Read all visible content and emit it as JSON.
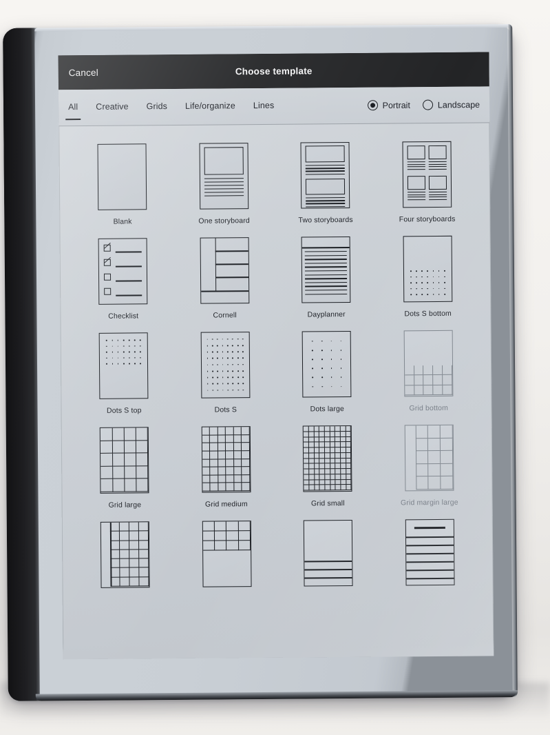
{
  "device": {
    "kind": "e-ink-tablet",
    "bezel_color": "#1d1d1f",
    "body_color": "#c9cfd5"
  },
  "screen": {
    "background_color": "#cbd0d6",
    "ink_color": "#1b1e23"
  },
  "topbar": {
    "cancel_label": "Cancel",
    "title": "Choose template",
    "background_color": "#232426",
    "text_color": "#f2f2f3"
  },
  "tabbar": {
    "tabs": [
      {
        "label": "All",
        "selected": true
      },
      {
        "label": "Creative",
        "selected": false
      },
      {
        "label": "Grids",
        "selected": false
      },
      {
        "label": "Life/organize",
        "selected": false
      },
      {
        "label": "Lines",
        "selected": false
      }
    ],
    "orientation": {
      "options": [
        {
          "label": "Portrait",
          "selected": true
        },
        {
          "label": "Landscape",
          "selected": false
        }
      ]
    }
  },
  "templates": {
    "rows": [
      [
        {
          "label": "Blank",
          "thumb": "blank",
          "dim": false
        },
        {
          "label": "One storyboard",
          "thumb": "one-storyboard",
          "dim": false
        },
        {
          "label": "Two storyboards",
          "thumb": "two-storyboards",
          "dim": false
        },
        {
          "label": "Four storyboards",
          "thumb": "four-storyboards",
          "dim": false
        }
      ],
      [
        {
          "label": "Checklist",
          "thumb": "checklist",
          "dim": false
        },
        {
          "label": "Cornell",
          "thumb": "cornell",
          "dim": false
        },
        {
          "label": "Dayplanner",
          "thumb": "dayplanner",
          "dim": false
        },
        {
          "label": "Dots S bottom",
          "thumb": "dots-s-bottom",
          "dim": false
        }
      ],
      [
        {
          "label": "Dots S top",
          "thumb": "dots-s-top",
          "dim": false
        },
        {
          "label": "Dots S",
          "thumb": "dots-s",
          "dim": false
        },
        {
          "label": "Dots large",
          "thumb": "dots-large",
          "dim": false
        },
        {
          "label": "Grid bottom",
          "thumb": "grid-bottom",
          "dim": true
        }
      ],
      [
        {
          "label": "Grid large",
          "thumb": "grid-large",
          "dim": false
        },
        {
          "label": "Grid medium",
          "thumb": "grid-medium",
          "dim": false
        },
        {
          "label": "Grid small",
          "thumb": "grid-small",
          "dim": false
        },
        {
          "label": "Grid margin large",
          "thumb": "grid-margin-large",
          "dim": true
        }
      ],
      [
        {
          "label": "",
          "thumb": "grid-margin-medium",
          "dim": false
        },
        {
          "label": "",
          "thumb": "grid-top",
          "dim": false
        },
        {
          "label": "",
          "thumb": "lines-bottom",
          "dim": false
        },
        {
          "label": "",
          "thumb": "lines-medium",
          "dim": false
        }
      ]
    ]
  }
}
